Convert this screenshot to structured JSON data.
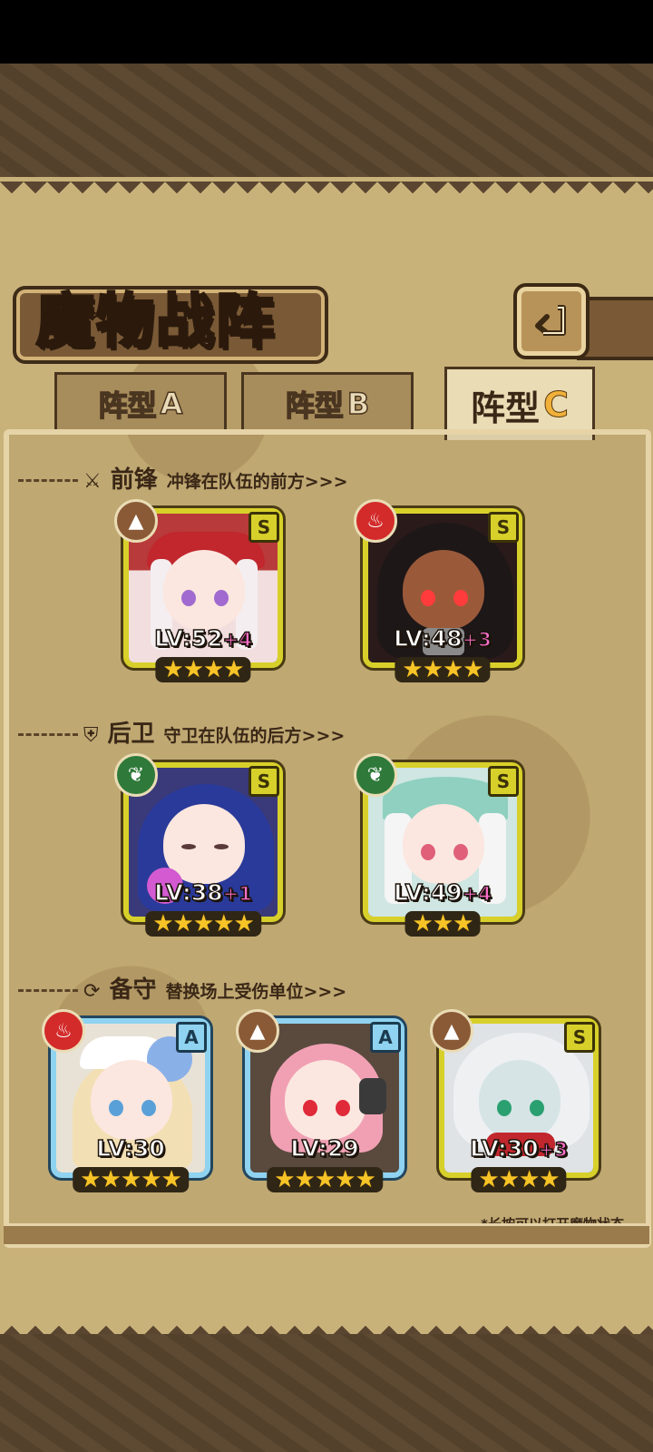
{
  "header": {
    "title": "魔物战阵",
    "back_icon": "return-arrow-icon"
  },
  "tabs": [
    {
      "label": "阵型",
      "letter": "A",
      "active": false
    },
    {
      "label": "阵型",
      "letter": "B",
      "active": false
    },
    {
      "label": "阵型",
      "letter": "C",
      "active": true
    }
  ],
  "sections": {
    "front": {
      "title": "前锋",
      "desc": "冲锋在队伍的前方>>>",
      "icon": "sword-icon"
    },
    "rear": {
      "title": "后卫",
      "desc": "守卫在队伍的后方>>>",
      "icon": "shield-icon"
    },
    "reserve": {
      "title": "备守",
      "desc": "替换场上受伤单位>>>",
      "icon": "swap-icon"
    }
  },
  "units": {
    "front": [
      {
        "level": "LV:52",
        "bonus": "+4",
        "rank": "S",
        "element": "earth",
        "stars": "★★★★"
      },
      {
        "level": "LV:48",
        "bonus": "+3",
        "rank": "S",
        "element": "fire",
        "stars": "★★★★"
      }
    ],
    "rear": [
      {
        "level": "LV:38",
        "bonus": "+1",
        "rank": "S",
        "element": "wood",
        "stars": "★★★★★"
      },
      {
        "level": "LV:49",
        "bonus": "+4",
        "rank": "S",
        "element": "wood",
        "stars": "★★★"
      }
    ],
    "reserve": [
      {
        "level": "LV:30",
        "bonus": "",
        "rank": "A",
        "element": "fire",
        "stars": "★★★★★"
      },
      {
        "level": "LV:29",
        "bonus": "",
        "rank": "A",
        "element": "earth",
        "stars": "★★★★★"
      },
      {
        "level": "LV:30",
        "bonus": "+3",
        "rank": "S",
        "element": "earth",
        "stars": "★★★★"
      }
    ]
  },
  "footnote": "*长按可以打开魔物状态",
  "colors": {
    "rank_s": "#d8d02a",
    "rank_a": "#8fd3f0",
    "plus": "#ff6fcf",
    "star": "#f7c427"
  }
}
